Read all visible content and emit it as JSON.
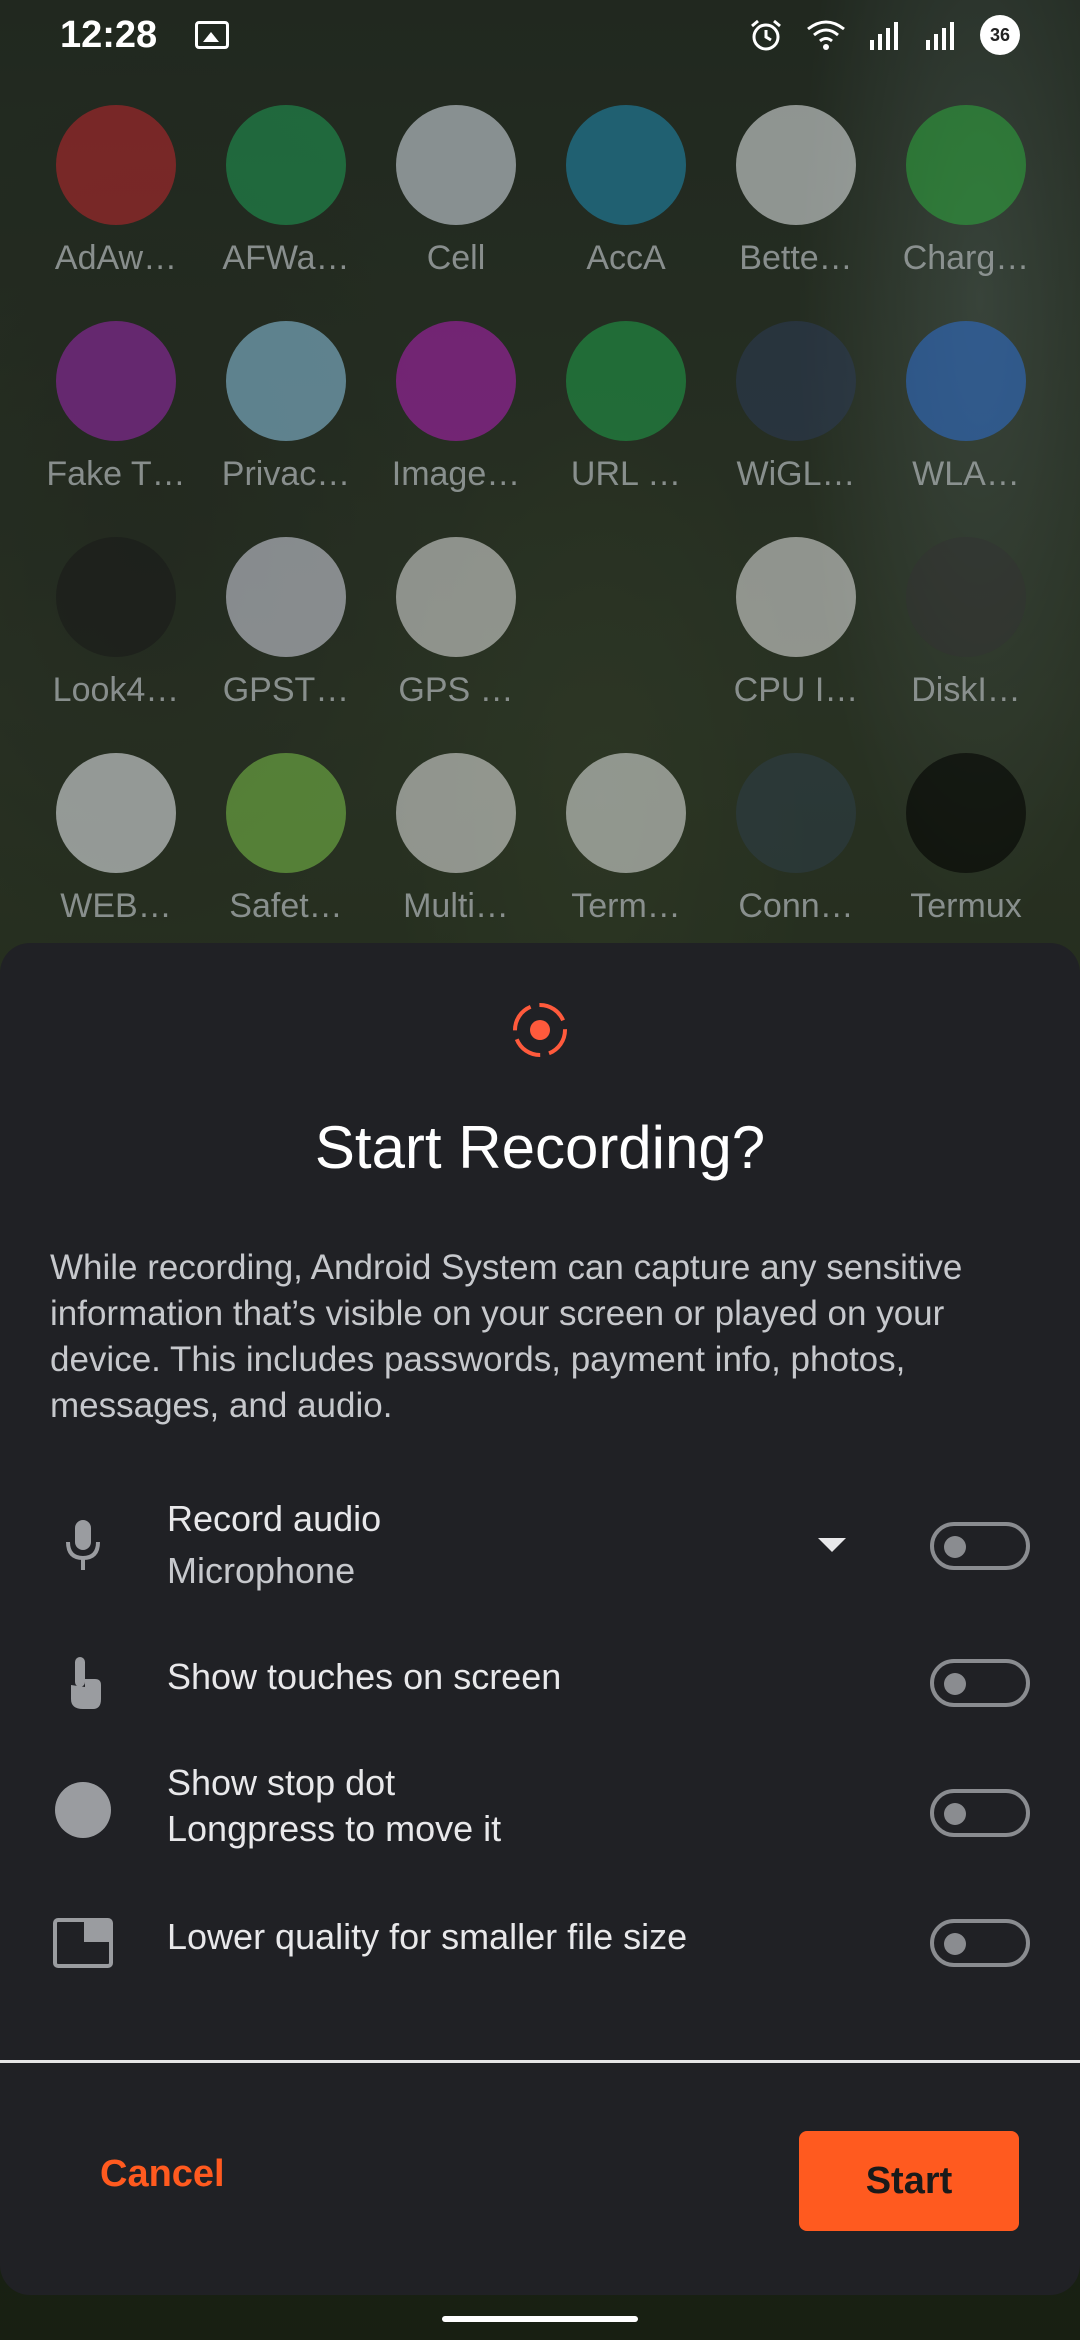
{
  "status_bar": {
    "time": "12:28",
    "battery": "36",
    "icons": [
      "gallery-icon",
      "alarm-icon",
      "wifi-icon",
      "signal-icon",
      "signal-icon",
      "battery-icon"
    ]
  },
  "apps": [
    {
      "label": "AdAw…",
      "icon": "dove-icon",
      "color": "#c0272d"
    },
    {
      "label": "AFWa…",
      "icon": "shield-check-icon",
      "color": "#1f9c55"
    },
    {
      "label": "Cell",
      "icon": "5g-icon",
      "color": "#dde4ee"
    },
    {
      "label": "AccA",
      "icon": "battery-bolt-icon",
      "color": "#1f8db5"
    },
    {
      "label": "Bette…",
      "icon": "battery-plus-icon",
      "color": "#e9ecef"
    },
    {
      "label": "Charg…",
      "icon": "plug-icon",
      "color": "#2eaa3e"
    },
    {
      "label": "Fake T…",
      "icon": "map-pin-icon",
      "color": "#9c27b0"
    },
    {
      "label": "Privac…",
      "icon": "traffic-light-icon",
      "color": "#8fcbe9"
    },
    {
      "label": "Image…",
      "icon": "image-shape-icon",
      "color": "#b21fb8"
    },
    {
      "label": "URL …",
      "icon": "broom-icon",
      "color": "#1fa04a"
    },
    {
      "label": "WiGL…",
      "icon": "globe-icon",
      "color": "#2b3a55"
    },
    {
      "label": "WLA…",
      "icon": "wifi-icon",
      "color": "#2d6fd1"
    },
    {
      "label": "Look4…",
      "icon": "satellite-icon",
      "color": "#1a1a1a"
    },
    {
      "label": "GPST…",
      "icon": "mountain-icon",
      "color": "#d9dbea"
    },
    {
      "label": "GPS …",
      "icon": "orbit-icon",
      "color": "#e3e3e3"
    },
    {
      "label": "",
      "icon": "",
      "color": "transparent"
    },
    {
      "label": "CPU I…",
      "icon": "chip-icon",
      "color": "#e8e8e8"
    },
    {
      "label": "DiskI…",
      "icon": "disk-bars-icon",
      "color": "#333333"
    },
    {
      "label": "WEB…",
      "icon": "webview-test-icon",
      "color": "#eef3f8"
    },
    {
      "label": "Safet…",
      "icon": "safety-people-icon",
      "color": "#7cc24a"
    },
    {
      "label": "Multi…",
      "icon": "network-tree-icon",
      "color": "#e7e7e7"
    },
    {
      "label": "Term…",
      "icon": "terminal-search-icon",
      "color": "#e5e8e8"
    },
    {
      "label": "Conn…",
      "icon": "terminal-icon",
      "color": "#2e3e48"
    },
    {
      "label": "Termux",
      "icon": "terminal-icon",
      "color": "#000000"
    }
  ],
  "dialog": {
    "title": "Start Recording?",
    "body": "While recording, Android System can capture any sensitive information that’s visible on your screen or played on your device. This includes passwords, payment info, photos, messages, and audio.",
    "options": [
      {
        "label": "Record audio",
        "sub": "Microphone",
        "icon": "microphone-icon",
        "enabled": false
      },
      {
        "label": "Show touches on screen",
        "sub": "",
        "icon": "touch-icon",
        "enabled": false
      },
      {
        "label": "Show stop dot",
        "sub": "Longpress to move it",
        "icon": "dot-icon",
        "enabled": false
      },
      {
        "label": "Lower quality for smaller file size",
        "sub": "",
        "icon": "window-icon",
        "enabled": false
      }
    ],
    "cancel_label": "Cancel",
    "start_label": "Start"
  },
  "colors": {
    "accent": "#ff5a1f",
    "dialog_bg": "#202125"
  }
}
